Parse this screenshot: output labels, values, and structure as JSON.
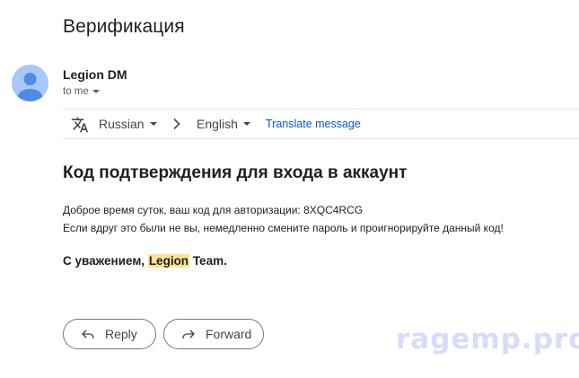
{
  "email": {
    "subject": "Верификация",
    "sender": {
      "name": "Legion DM",
      "to_label": "to me"
    }
  },
  "translate_bar": {
    "source_language": "Russian",
    "target_language": "English",
    "link_label": "Translate message"
  },
  "body": {
    "heading": "Код подтверждения для входа в аккаунт",
    "line1": "Доброе время суток, ваш код для авторизации: 8XQC4RCG",
    "line2": "Если вдруг это были не вы, немедленно смените пароль и проигнорируйте данный код!",
    "signature_prefix": "С уважением, ",
    "signature_highlight": "Legion",
    "signature_suffix": " Team."
  },
  "actions": {
    "reply_label": "Reply",
    "forward_label": "Forward"
  },
  "watermark": "ragemp.pro",
  "colors": {
    "avatar_bg": "#a8c7fa",
    "avatar_figure": "#0b57d0",
    "link": "#0b57d0",
    "highlight": "#fde293"
  }
}
